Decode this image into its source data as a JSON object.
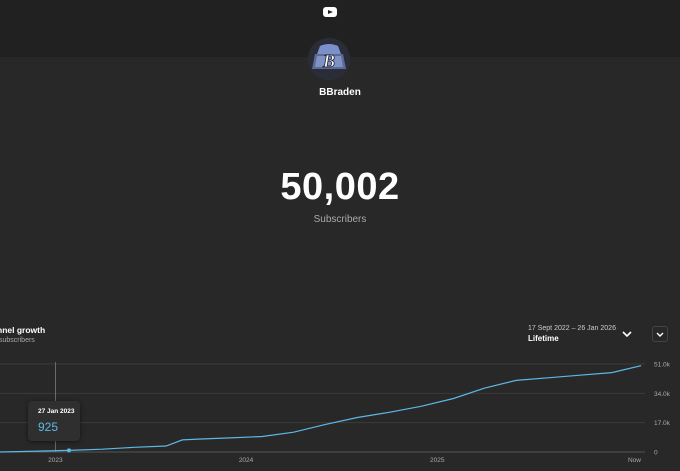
{
  "header": {
    "logo": "youtube-play-icon"
  },
  "channel": {
    "name": "BBraden",
    "avatar_letter": "B"
  },
  "stats": {
    "subscribers": "50,002",
    "subscribers_label": "Subscribers"
  },
  "growth": {
    "title": "nnel growth",
    "subtitle": "subscribers",
    "date_range": "17 Sept 2022 – 26 Jan 2026",
    "range_value": "Lifetime"
  },
  "tooltip": {
    "date": "27 Jan 2023",
    "value": "925"
  },
  "colors": {
    "line": "#5db8e6",
    "background": "#282828",
    "topbar": "#212121"
  },
  "chart_data": {
    "type": "line",
    "x_tick_labels": [
      "2023",
      "2024",
      "2025",
      "Now"
    ],
    "y_tick_labels": [
      "51.0k",
      "34.0k",
      "17.0k",
      "0"
    ],
    "ylim": [
      0,
      51000
    ],
    "series": [
      {
        "x": [
          "2022-09-17",
          "2022-12-01",
          "2023-01-27",
          "2023-04-01",
          "2023-06-01",
          "2023-08-01",
          "2023-09-01",
          "2023-10-01",
          "2023-12-01",
          "2024-02-01",
          "2024-04-01",
          "2024-06-01",
          "2024-08-01",
          "2024-10-01",
          "2024-12-01",
          "2025-02-01",
          "2025-04-01",
          "2025-06-01",
          "2025-08-01",
          "2025-10-01",
          "2025-12-01",
          "2026-01-26"
        ],
        "values": [
          0,
          500,
          925,
          1600,
          2700,
          3500,
          7000,
          7500,
          8200,
          9000,
          11500,
          16000,
          20000,
          23000,
          26500,
          31000,
          37000,
          41500,
          43000,
          44500,
          46000,
          50002
        ]
      }
    ]
  }
}
